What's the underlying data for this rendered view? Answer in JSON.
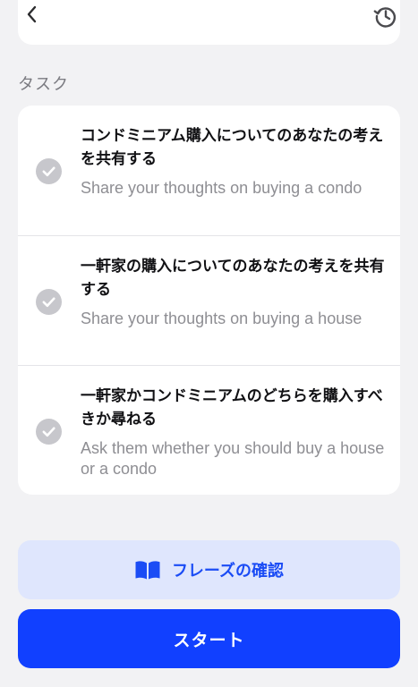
{
  "header": {
    "back_icon": "chevron-left-icon",
    "history_icon": "history-icon"
  },
  "tasks_section": {
    "title": "タスク",
    "items": [
      {
        "title_ja": "コンドミニアム購入についてのあなたの考えを共有する",
        "subtitle_en": "Share your thoughts on buying a condo",
        "status_icon": "checkmark-circle-icon"
      },
      {
        "title_ja": "一軒家の購入についてのあなたの考えを共有する",
        "subtitle_en": "Share your thoughts on buying a house",
        "status_icon": "checkmark-circle-icon"
      },
      {
        "title_ja": "一軒家かコンドミニアムのどちらを購入すべきか尋ねる",
        "subtitle_en": "Ask them whether you should buy a house or a condo",
        "status_icon": "checkmark-circle-icon"
      }
    ]
  },
  "buttons": {
    "phrases_label": "フレーズの確認",
    "phrases_icon": "book-icon",
    "start_label": "スタート"
  },
  "colors": {
    "accent": "#1140ff",
    "phrase_button_bg": "#dfe6fd",
    "check_gray": "#c7c7cc",
    "background": "#f2f2f4"
  }
}
